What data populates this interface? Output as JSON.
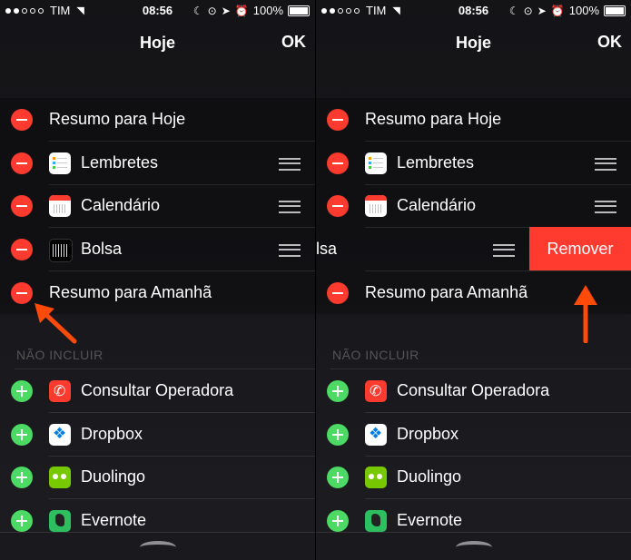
{
  "status_bar": {
    "carrier": "TIM",
    "time": "08:56",
    "battery": "100%"
  },
  "header": {
    "title": "Hoje",
    "done": "OK"
  },
  "active_widgets": [
    {
      "label": "Resumo para Hoje"
    },
    {
      "label": "Lembretes",
      "icon": "reminders-icon"
    },
    {
      "label": "Calendário",
      "icon": "calendar-icon"
    },
    {
      "label": "Bolsa",
      "icon": "stocks-icon"
    },
    {
      "label": "Resumo para Amanhã"
    }
  ],
  "swiped_label_fragment": "lsa",
  "section_not_included": "NÃO INCLUIR",
  "inactive_widgets": [
    {
      "label": "Consultar Operadora",
      "icon": "phone-icon"
    },
    {
      "label": "Dropbox",
      "icon": "dropbox-icon"
    },
    {
      "label": "Duolingo",
      "icon": "duolingo-icon"
    },
    {
      "label": "Evernote",
      "icon": "evernote-icon"
    }
  ],
  "remove_button": "Remover",
  "colors": {
    "delete": "#ff3b30",
    "add": "#4cd964",
    "arrow": "#ff4a0a"
  }
}
